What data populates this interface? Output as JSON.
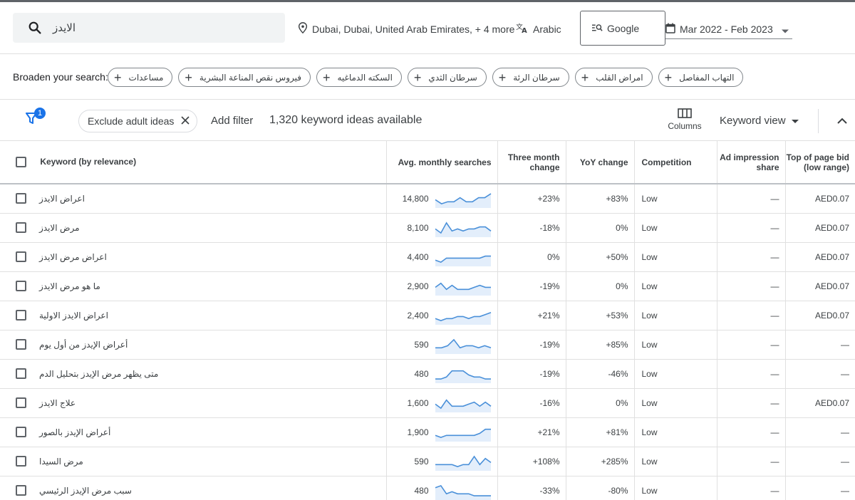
{
  "topbar": {
    "search_value": "الايدز",
    "location": "Dubai, Dubai, United Arab Emirates, + 4 more",
    "language": "Arabic",
    "search_engine": "Google",
    "date_range": "Mar 2022 - Feb 2023"
  },
  "broaden": {
    "label": "Broaden your search:",
    "chips": [
      "مساعدات",
      "فيروس نقص المناعة البشرية",
      "السكته الدماغيه",
      "سرطان الثدي",
      "سرطان الرئة",
      "امراض القلب",
      "التهاب المفاصل"
    ]
  },
  "filterbar": {
    "filter_badge": "1",
    "exclude_chip": "Exclude adult ideas",
    "add_filter": "Add filter",
    "keyword_count": "1,320 keyword ideas available",
    "columns_label": "Columns",
    "keyword_view": "Keyword view"
  },
  "table": {
    "headers": {
      "keyword": "Keyword (by relevance)",
      "searches": "Avg. monthly searches",
      "three_month": "Three month change",
      "yoy": "YoY change",
      "competition": "Competition",
      "impression": "Ad impression share",
      "bid": "Top of page bid (low range)"
    },
    "rows": [
      {
        "keyword": "اعراض الايدز",
        "searches": "14,800",
        "trend": [
          3,
          1,
          2,
          2,
          4,
          2,
          2,
          4,
          4,
          6
        ],
        "three_month": "+23%",
        "yoy": "+83%",
        "competition": "Low",
        "impression": "—",
        "bid": "AED0.07"
      },
      {
        "keyword": "مرض الايدز",
        "searches": "8,100",
        "trend": [
          3,
          1,
          6,
          2,
          3,
          2,
          3,
          3,
          4,
          4,
          2
        ],
        "three_month": "-18%",
        "yoy": "0%",
        "competition": "Low",
        "impression": "—",
        "bid": "AED0.07"
      },
      {
        "keyword": "اعراض مرض الايدز",
        "searches": "4,400",
        "trend": [
          2,
          1,
          3,
          3,
          3,
          3,
          3,
          3,
          3,
          4,
          4
        ],
        "three_month": "0%",
        "yoy": "+50%",
        "competition": "Low",
        "impression": "—",
        "bid": "AED0.07"
      },
      {
        "keyword": "ما هو مرض الايدز",
        "searches": "2,900",
        "trend": [
          3,
          5,
          2,
          4,
          2,
          2,
          2,
          3,
          4,
          3,
          3
        ],
        "three_month": "-19%",
        "yoy": "0%",
        "competition": "Low",
        "impression": "—",
        "bid": "AED0.07"
      },
      {
        "keyword": "اعراض الايدز الاولية",
        "searches": "2,400",
        "trend": [
          2,
          1,
          2,
          2,
          3,
          3,
          2,
          3,
          3,
          4,
          5
        ],
        "three_month": "+21%",
        "yoy": "+53%",
        "competition": "Low",
        "impression": "—",
        "bid": "AED0.07"
      },
      {
        "keyword": "أعراض الإيدز من أول يوم",
        "searches": "590",
        "trend": [
          2,
          2,
          3,
          6,
          2,
          3,
          3,
          2,
          3,
          2
        ],
        "three_month": "-19%",
        "yoy": "+85%",
        "competition": "Low",
        "impression": "—",
        "bid": "—"
      },
      {
        "keyword": "متى يظهر مرض الإيدز بتحليل الدم",
        "searches": "480",
        "trend": [
          1,
          1,
          2,
          5,
          5,
          5,
          3,
          2,
          2,
          1,
          1
        ],
        "three_month": "-19%",
        "yoy": "-46%",
        "competition": "Low",
        "impression": "—",
        "bid": "—"
      },
      {
        "keyword": "علاج الايدز",
        "searches": "1,600",
        "trend": [
          3,
          1,
          5,
          2,
          2,
          2,
          3,
          4,
          2,
          4,
          2
        ],
        "three_month": "-16%",
        "yoy": "0%",
        "competition": "Low",
        "impression": "—",
        "bid": "AED0.07"
      },
      {
        "keyword": "أعراض الإيدز بالصور",
        "searches": "1,900",
        "trend": [
          2,
          1,
          2,
          2,
          2,
          2,
          2,
          2,
          3,
          5,
          5
        ],
        "three_month": "+21%",
        "yoy": "+81%",
        "competition": "Low",
        "impression": "—",
        "bid": "—"
      },
      {
        "keyword": "مرض السيدا",
        "searches": "590",
        "trend": [
          2,
          2,
          2,
          2,
          1,
          2,
          2,
          6,
          2,
          5,
          3
        ],
        "three_month": "+108%",
        "yoy": "+285%",
        "competition": "Low",
        "impression": "—",
        "bid": "—"
      },
      {
        "keyword": "سبب مرض الإيدز الرئيسي",
        "searches": "480",
        "trend": [
          5,
          6,
          2,
          3,
          2,
          2,
          2,
          1,
          1,
          1,
          1
        ],
        "three_month": "-33%",
        "yoy": "-80%",
        "competition": "Low",
        "impression": "—",
        "bid": "—"
      }
    ]
  },
  "colors": {
    "accent": "#1a73e8",
    "spark_line": "#4a90d9",
    "spark_fill": "#e3eefb"
  },
  "icons": [
    "search-icon",
    "location-pin-icon",
    "translate-icon",
    "search-engine-icon",
    "calendar-icon",
    "chevron-down-icon",
    "plus-icon",
    "filter-icon",
    "close-icon",
    "columns-icon",
    "chevron-up-icon"
  ]
}
